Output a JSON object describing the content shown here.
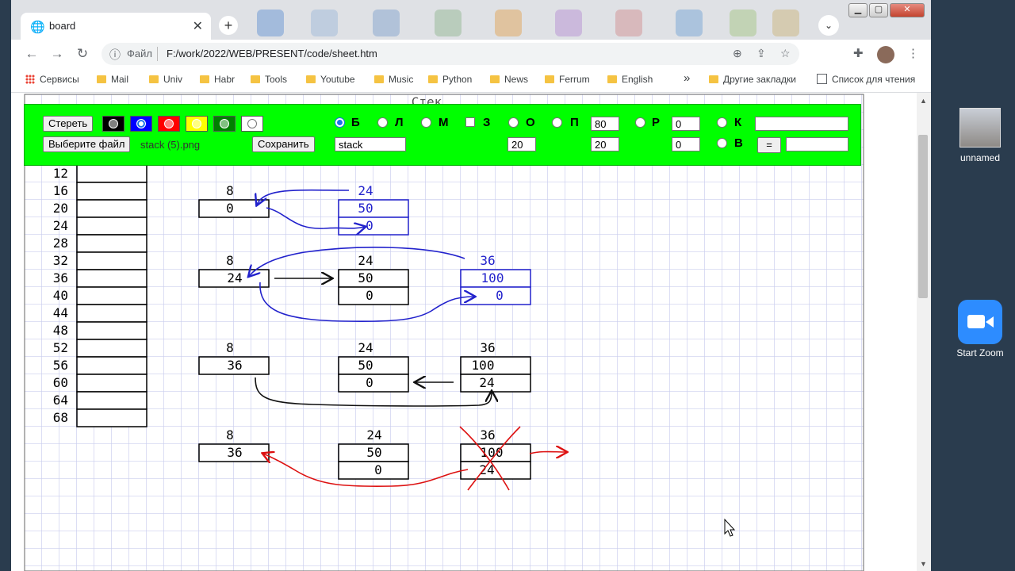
{
  "desktop": {
    "icons": [
      {
        "label": "unnamed"
      },
      {
        "label": "Start Zoom"
      }
    ]
  },
  "tab": {
    "title": "board",
    "close": "✕",
    "new_tab": "+"
  },
  "window_controls": {
    "minimize": "▁",
    "maximize": "▢",
    "close": "✕"
  },
  "address": {
    "scheme_label": "Файл",
    "url": "F:/work/2022/WEB/PRESENT/code/sheet.htm"
  },
  "bookmarks": {
    "apps": "Сервисы",
    "items": [
      "Mail",
      "Univ",
      "Habr",
      "Tools",
      "Youtube",
      "Music",
      "Python",
      "News",
      "Ferrum",
      "English"
    ],
    "more": "»",
    "other": "Другие закладки",
    "reading_list": "Список для чтения"
  },
  "panel": {
    "erase_button": "Стереть",
    "choose_file_button": "Выберите файл",
    "file_name": "stack (5).png",
    "save_button": "Сохранить",
    "name_field": "stack",
    "colors": [
      "#000000",
      "#0000ff",
      "#ff0000",
      "#ffff00",
      "#008000",
      "#ffffff"
    ],
    "selected_color_index": 1,
    "tools": [
      "Б",
      "Л",
      "М",
      "З",
      "О",
      "П",
      "Р",
      "К",
      "В"
    ],
    "selected_tool": "Б",
    "fields": {
      "o_value": "20",
      "p_width": "80",
      "p_height": "20",
      "r_top": "0",
      "r_bottom": "0",
      "k_value": "",
      "eq_button": "=",
      "v_value": ""
    }
  },
  "sheet": {
    "title_fragment": "Стек",
    "addresses": [
      "12",
      "16",
      "20",
      "24",
      "28",
      "32",
      "36",
      "40",
      "44",
      "48",
      "52",
      "56",
      "60",
      "64",
      "68"
    ],
    "diagrams": [
      {
        "a_addr": "8",
        "a_val": "0",
        "b_addr": "24",
        "b_vals": [
          "50",
          "0"
        ]
      },
      {
        "a_addr": "8",
        "a_val": "24",
        "b_addr": "24",
        "b_vals": [
          "50",
          "0"
        ],
        "c_addr": "36",
        "c_vals": [
          "100",
          "0"
        ]
      },
      {
        "a_addr": "8",
        "a_val": "36",
        "b_addr": "24",
        "b_vals": [
          "50",
          "0"
        ],
        "c_addr": "36",
        "c_vals": [
          "100",
          "24"
        ]
      },
      {
        "a_addr": "8",
        "a_val": "36",
        "b_addr": "24",
        "b_vals": [
          "50",
          "0"
        ],
        "c_addr": "36",
        "c_vals": [
          "100",
          "24"
        ]
      }
    ]
  }
}
